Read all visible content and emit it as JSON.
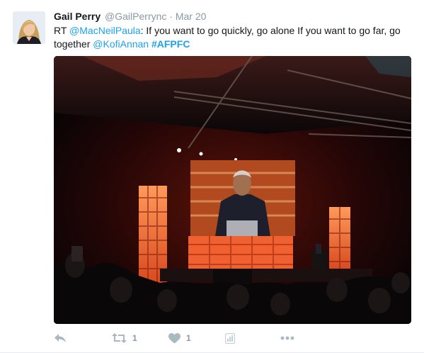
{
  "tweet": {
    "fullname": "Gail Perry",
    "handle": "@GailPerrync",
    "separator": "·",
    "time": "Mar 20",
    "text": {
      "prefix": "RT ",
      "mention1": "@MacNeilPaula",
      "body": ": If you want to go quickly, go alone If you want to go far, go together ",
      "mention2": "@KofiAnnan",
      "space": " ",
      "hashtag": "#AFPFC"
    },
    "media": {
      "icon": "photo",
      "description_icon": "concert-stage-photo"
    },
    "actions": {
      "reply": {
        "icon": "reply-icon"
      },
      "retweet": {
        "icon": "retweet-icon",
        "count": "1"
      },
      "like": {
        "icon": "heart-icon",
        "count": "1"
      },
      "analytics": {
        "icon": "analytics-icon"
      },
      "more": {
        "icon": "more-icon"
      }
    }
  },
  "colors": {
    "link": "#1da1f2",
    "text": "#14171a",
    "muted": "#8899a6",
    "icon": "#aab8c2"
  }
}
